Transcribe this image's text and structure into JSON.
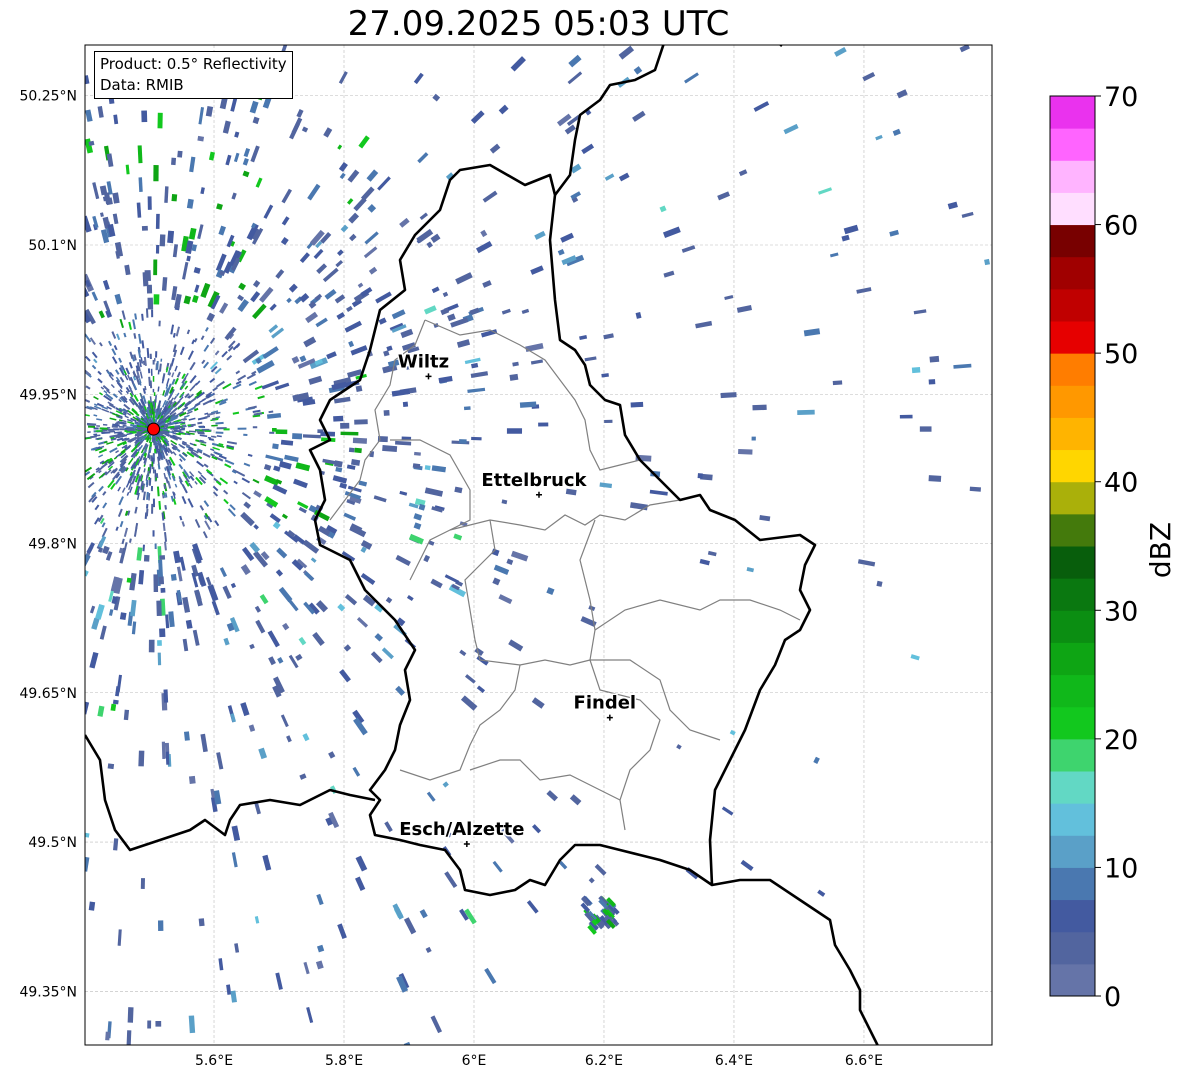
{
  "title": "27.09.2025 05:03 UTC",
  "info": {
    "product": "Product: 0.5° Reflectivity",
    "data": "Data: RMIB"
  },
  "map": {
    "lon_range": [
      5.4015,
      6.797
    ],
    "lat_range": [
      49.296,
      50.301
    ],
    "lon_ticks": [
      {
        "value": 5.6,
        "label": "5.6°E"
      },
      {
        "value": 5.8,
        "label": "5.8°E"
      },
      {
        "value": 6.0,
        "label": "6°E"
      },
      {
        "value": 6.2,
        "label": "6.2°E"
      },
      {
        "value": 6.4,
        "label": "6.4°E"
      },
      {
        "value": 6.6,
        "label": "6.6°E"
      }
    ],
    "lat_ticks": [
      {
        "value": 50.25,
        "label": "50.25°N"
      },
      {
        "value": 50.1,
        "label": "50.1°N"
      },
      {
        "value": 49.95,
        "label": "49.95°N"
      },
      {
        "value": 49.8,
        "label": "49.8°N"
      },
      {
        "value": 49.65,
        "label": "49.65°N"
      },
      {
        "value": 49.5,
        "label": "49.5°N"
      },
      {
        "value": 49.35,
        "label": "49.35°N"
      }
    ],
    "radar_site": {
      "lon": 5.507,
      "lat": 49.915,
      "color": "#ff0000"
    },
    "cities": [
      {
        "name": "Wiltz",
        "lon": 5.93,
        "lat": 49.968
      },
      {
        "name": "Ettelbruck",
        "lon": 6.1,
        "lat": 49.849
      },
      {
        "name": "Findel",
        "lon": 6.209,
        "lat": 49.625
      },
      {
        "name": "Esch/Alzette",
        "lon": 5.989,
        "lat": 49.498
      }
    ]
  },
  "colorbar": {
    "label": "dBZ",
    "min": 0,
    "max": 70,
    "ticks": [
      "0",
      "10",
      "20",
      "30",
      "40",
      "50",
      "60",
      "70"
    ],
    "colors": [
      "#6574a8",
      "#52659f",
      "#435aa0",
      "#4a78b0",
      "#5aa0c8",
      "#62c0dc",
      "#62d8c4",
      "#3ed46e",
      "#12c81e",
      "#10b81a",
      "#0ea514",
      "#0b8e12",
      "#0a7810",
      "#085e0c",
      "#447a0c",
      "#aab00a",
      "#ffd600",
      "#ffb400",
      "#ff9800",
      "#ff7d00",
      "#e60000",
      "#c00000",
      "#a00000",
      "#780000",
      "#ffdeff",
      "#ffb4ff",
      "#ff64ff",
      "#ea32ee"
    ]
  }
}
